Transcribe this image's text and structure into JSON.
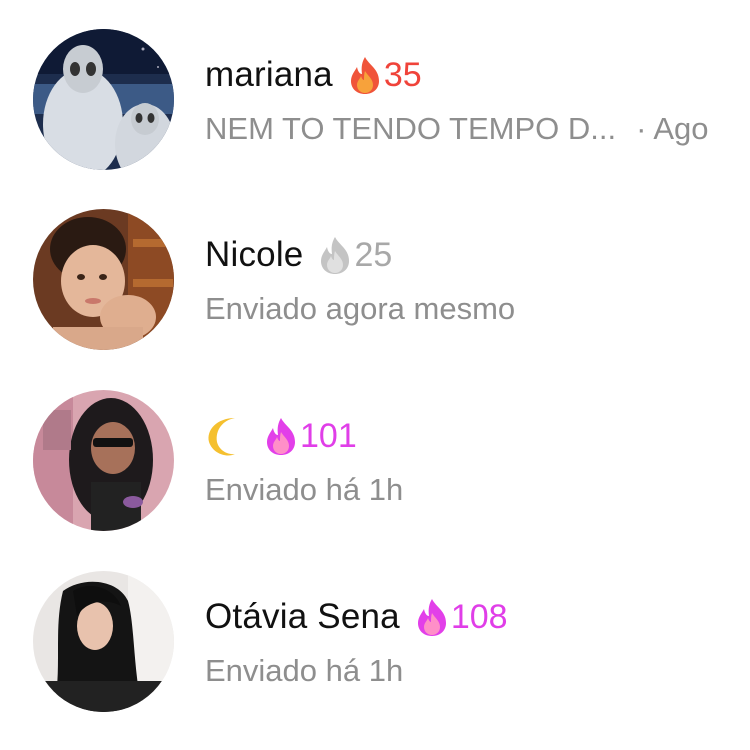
{
  "conversations": [
    {
      "name": "mariana",
      "streak": {
        "count": "35",
        "color": "#f0433a",
        "style": "orange"
      },
      "preview": "NEM TO TENDO TEMPO D...",
      "time": "· Ago"
    },
    {
      "name": "Nicole",
      "streak": {
        "count": "25",
        "color": "#a8a8a8",
        "style": "gray"
      },
      "preview": "Enviado agora mesmo"
    },
    {
      "name_icon": "crescent-moon-icon",
      "streak": {
        "count": "101",
        "color": "#e03ee8",
        "style": "pink"
      },
      "preview": "Enviado há 1h"
    },
    {
      "name": "Otávia Sena",
      "streak": {
        "count": "108",
        "color": "#e03ee8",
        "style": "pink"
      },
      "preview": "Enviado há 1h"
    }
  ]
}
